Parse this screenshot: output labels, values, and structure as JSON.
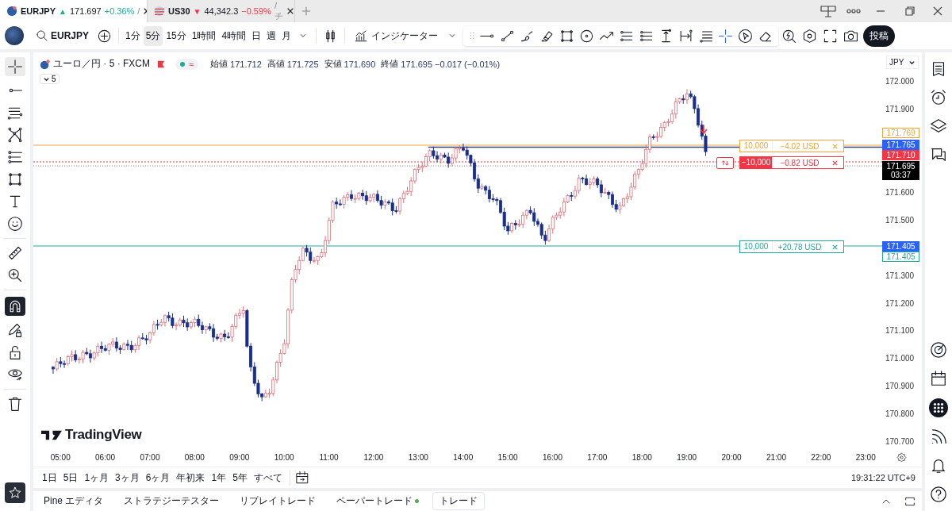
{
  "browser_tabs": [
    {
      "symbol": "EURJPY",
      "arrow": "▲",
      "rising": true,
      "price": "171.697",
      "change": "+0.36%",
      "tail": "/",
      "selected": true
    },
    {
      "symbol": "US30",
      "arrow": "▼",
      "rising": false,
      "price": "44,342.3",
      "change": "−0.59%",
      "tail": "/ チ",
      "selected": false
    }
  ],
  "toolbar": {
    "symbol": "EURJPY",
    "intervals": [
      {
        "label": "1分",
        "selected": false
      },
      {
        "label": "5分",
        "selected": true
      },
      {
        "label": "15分",
        "selected": false
      },
      {
        "label": "1時間",
        "selected": false
      },
      {
        "label": "4時間",
        "selected": false
      },
      {
        "label": "日",
        "selected": false
      },
      {
        "label": "週",
        "selected": false
      },
      {
        "label": "月",
        "selected": false
      }
    ],
    "indicators": "インジケーター",
    "publish": "投稿"
  },
  "drawing_tools": {
    "cursor_selected": true,
    "magnet_on": true
  },
  "legend": {
    "title": "ユーロ／円 · 5 · FXCM",
    "status_symbol": "≈",
    "ohlc": [
      {
        "label": "始値",
        "value": "171.712"
      },
      {
        "label": "高値",
        "value": "171.725"
      },
      {
        "label": "安値",
        "value": "171.690"
      },
      {
        "label": "終値",
        "value": "171.695"
      }
    ],
    "change": "−0.017 (−0.01%)",
    "collapsed_count": "5"
  },
  "orders": [
    {
      "kind": "order",
      "quantity": "10,000",
      "pnl": "−4.02 USD",
      "color": "#f0a53a"
    },
    {
      "kind": "position",
      "quantity": "−10,000",
      "pnl": "−0.82 USD",
      "color": "#f23645"
    },
    {
      "kind": "order",
      "quantity": "10,000",
      "pnl": "+20.78 USD",
      "color": "#22ab94"
    }
  ],
  "watermark": "TradingView",
  "price_axis": {
    "currency": "JPY",
    "ticks": [
      "172.000",
      "171.900",
      "171.600",
      "171.500",
      "171.300",
      "171.200",
      "171.100",
      "171.000",
      "170.900",
      "170.800",
      "170.700"
    ],
    "markers": [
      {
        "kind": "outline",
        "price": "171.769",
        "color": "#f0a53a"
      },
      {
        "kind": "filled",
        "price": "171.765",
        "color": "#2962ff"
      },
      {
        "kind": "filled",
        "price": "171.710",
        "color": "#f23645"
      },
      {
        "kind": "filled",
        "price": "171.695",
        "countdown": "03:37",
        "color": "#000000"
      },
      {
        "kind": "filled",
        "price": "171.405",
        "color": "#2962ff"
      },
      {
        "kind": "outline",
        "price": "171.405",
        "color": "#22ab94"
      }
    ]
  },
  "time_axis": [
    "05:00",
    "06:00",
    "07:00",
    "08:00",
    "09:00",
    "10:00",
    "11:00",
    "12:00",
    "13:00",
    "14:00",
    "15:00",
    "16:00",
    "17:00",
    "18:00",
    "19:00",
    "20:00",
    "21:00",
    "22:00",
    "23:00"
  ],
  "ranges": [
    "1日",
    "5日",
    "1ヶ月",
    "3ヶ月",
    "6ヶ月",
    "年初来",
    "1年",
    "5年",
    "すべて"
  ],
  "clock": "19:31:22 UTC+9",
  "bottom_tabs": [
    {
      "label": "Pine エディタ",
      "status_dot": false,
      "selected": false
    },
    {
      "label": "ストラテジーテスター",
      "status_dot": false,
      "selected": false
    },
    {
      "label": "リプレイトレード",
      "status_dot": false,
      "selected": false
    },
    {
      "label": "ペーパートレード",
      "status_dot": true,
      "selected": false
    },
    {
      "label": "トレード",
      "status_dot": false,
      "selected": true
    }
  ]
}
